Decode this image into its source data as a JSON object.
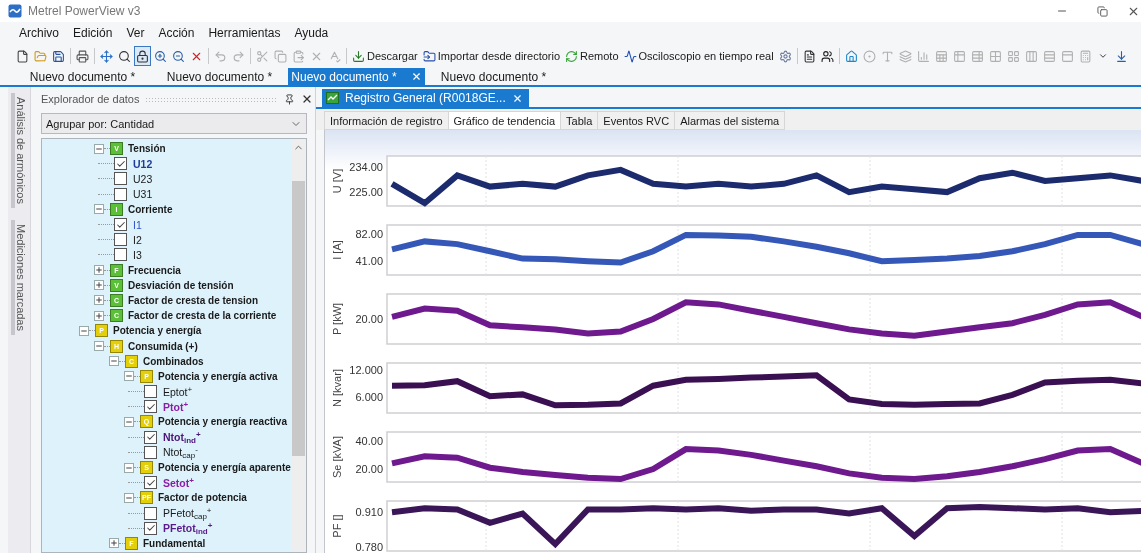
{
  "window": {
    "title": "Metrel PowerView v3"
  },
  "menu": [
    "Archivo",
    "Edición",
    "Ver",
    "Acción",
    "Herramientas",
    "Ayuda"
  ],
  "toolbar": [
    {
      "kind": "icon",
      "on": false,
      "disabled": false
    },
    {
      "kind": "icon",
      "on": false,
      "disabled": false
    },
    {
      "kind": "icon",
      "on": false,
      "disabled": false
    },
    {
      "kind": "separator"
    },
    {
      "kind": "icon",
      "on": false,
      "disabled": false
    },
    {
      "kind": "separator"
    },
    {
      "kind": "icon",
      "on": false,
      "disabled": false
    },
    {
      "kind": "icon",
      "on": false,
      "disabled": false
    },
    {
      "kind": "icon",
      "on": true,
      "disabled": false
    },
    {
      "kind": "icon",
      "on": false,
      "disabled": false
    },
    {
      "kind": "icon",
      "on": false,
      "disabled": false
    },
    {
      "kind": "icon",
      "on": false,
      "disabled": false
    },
    {
      "kind": "separator"
    },
    {
      "kind": "icon",
      "on": false,
      "disabled": true
    },
    {
      "kind": "icon",
      "on": false,
      "disabled": true
    },
    {
      "kind": "separator"
    },
    {
      "kind": "icon",
      "on": false,
      "disabled": true
    },
    {
      "kind": "icon",
      "on": false,
      "disabled": true
    },
    {
      "kind": "icon",
      "on": false,
      "disabled": true
    },
    {
      "kind": "icon",
      "on": false,
      "disabled": true
    },
    {
      "kind": "icon",
      "on": false,
      "disabled": true
    },
    {
      "kind": "separator"
    },
    {
      "kind": "button",
      "label": "Descargar"
    },
    {
      "kind": "button",
      "label": "Importar desde directorio"
    },
    {
      "kind": "button",
      "label": "Remoto"
    },
    {
      "kind": "button",
      "label": "Osciloscopio en tiempo real"
    },
    {
      "kind": "icon",
      "on": false,
      "disabled": false
    },
    {
      "kind": "separator"
    },
    {
      "kind": "icon",
      "on": false,
      "disabled": false
    },
    {
      "kind": "icon",
      "on": false,
      "disabled": false
    },
    {
      "kind": "separator"
    },
    {
      "kind": "icon",
      "on": false,
      "disabled": false
    },
    {
      "kind": "icon",
      "on": false,
      "disabled": true
    },
    {
      "kind": "icon",
      "on": false,
      "disabled": true
    },
    {
      "kind": "icon",
      "on": false,
      "disabled": true
    },
    {
      "kind": "icon",
      "on": false,
      "disabled": true
    },
    {
      "kind": "icon",
      "on": false,
      "disabled": true
    },
    {
      "kind": "icon",
      "on": false,
      "disabled": true
    },
    {
      "kind": "icon",
      "on": false,
      "disabled": true
    },
    {
      "kind": "icon",
      "on": false,
      "disabled": true
    },
    {
      "kind": "icon",
      "on": false,
      "disabled": true
    },
    {
      "kind": "icon",
      "on": false,
      "disabled": true
    },
    {
      "kind": "icon",
      "on": false,
      "disabled": true
    },
    {
      "kind": "icon",
      "on": false,
      "disabled": true
    },
    {
      "kind": "icon",
      "on": false,
      "disabled": true
    },
    {
      "kind": "overflow"
    },
    {
      "kind": "icon",
      "on": false,
      "disabled": false
    }
  ],
  "documents": [
    {
      "label": "Nuevo documento *",
      "selected": false
    },
    {
      "label": "Nuevo documento *",
      "selected": false
    },
    {
      "label": "Nuevo documento *",
      "selected": true
    },
    {
      "label": "Nuevo documento *",
      "selected": false
    }
  ],
  "side_tabs": [
    "Análisis de armónicos",
    "Mediciones marcadas"
  ],
  "explorer": {
    "title": "Explorador de datos",
    "group_by": "Agrupar por: Cantidad",
    "tree": [
      {
        "children": [
          {
            "label": "Tensión",
            "badge": "V",
            "color": "#5cbf38",
            "expanded": true,
            "children": [
              {
                "label": "U12",
                "checked": true,
                "bold": true,
                "color": "#1f3c9a"
              },
              {
                "label": "U23",
                "checked": false,
                "bold": false
              },
              {
                "label": "U31",
                "checked": false,
                "bold": false
              }
            ]
          },
          {
            "label": "Corriente",
            "badge": "I",
            "color": "#5cbf38",
            "expanded": true,
            "children": [
              {
                "label": "I1",
                "checked": true,
                "bold": false,
                "color": "#2f55c8"
              },
              {
                "label": "I2",
                "checked": false,
                "bold": false
              },
              {
                "label": "I3",
                "checked": false,
                "bold": false
              }
            ]
          },
          {
            "label": "Frecuencia",
            "badge": "F",
            "color": "#5cbf38",
            "expanded": false
          },
          {
            "label": "Desviación de tensión",
            "badge": "V",
            "color": "#5cbf38",
            "expanded": false
          },
          {
            "label": "Factor de cresta de tension",
            "badge": "C",
            "color": "#5cbf38",
            "expanded": false
          },
          {
            "label": "Factor de cresta de la corriente",
            "badge": "C",
            "color": "#5cbf38",
            "expanded": false
          }
        ]
      },
      {
        "label": "Potencia y energía",
        "badge": "P",
        "color": "#e3cf0a",
        "expanded": true,
        "children": [
          {
            "label": "Consumida (+)",
            "badge": "H",
            "color": "#e3cf0a",
            "expanded": true,
            "children": [
              {
                "label": "Combinados",
                "badge": "C",
                "color": "#e3cf0a",
                "expanded": true,
                "children": [
                  {
                    "label": "Potencia y energía activa",
                    "badge": "P",
                    "color": "#e3cf0a",
                    "expanded": true,
                    "children": [
                      {
                        "label": "Eptot$^{+}$",
                        "checked": false,
                        "bold": false
                      },
                      {
                        "label": "Ptot$^{+}$",
                        "checked": true,
                        "bold": true,
                        "color": "#8a1fa3"
                      }
                    ]
                  },
                  {
                    "label": "Potencia y energía reactiva",
                    "badge": "Q",
                    "color": "#e3cf0a",
                    "expanded": true,
                    "children": [
                      {
                        "label": "Ntot$_{ind}$$^{+}$",
                        "checked": true,
                        "bold": true,
                        "color": "#4a1578"
                      },
                      {
                        "label": "Ntot$_{cap}$$^{-}$",
                        "checked": false,
                        "bold": false
                      }
                    ]
                  },
                  {
                    "label": "Potencia y energía aparente",
                    "badge": "S",
                    "color": "#e3cf0a",
                    "expanded": true,
                    "children": [
                      {
                        "label": "Setot$^{+}$",
                        "checked": true,
                        "bold": true,
                        "color": "#8a1fa3"
                      }
                    ]
                  },
                  {
                    "label": "Factor de potencia",
                    "badge": "PF",
                    "color": "#e3cf0a",
                    "expanded": true,
                    "children": [
                      {
                        "label": "PFetot$_{cap}$$^{+}$",
                        "checked": false,
                        "bold": false
                      },
                      {
                        "label": "PFetot$_{ind}$$^{+}$",
                        "checked": true,
                        "bold": true,
                        "color": "#5a1a8a"
                      }
                    ]
                  }
                ]
              },
              {
                "label": "Fundamental",
                "badge": "F",
                "color": "#e3cf0a",
                "expanded": false
              }
            ]
          }
        ]
      }
    ]
  },
  "record_tab": {
    "label": "Registro General (R0018GE..."
  },
  "view_tabs": [
    {
      "label": "Información de registro",
      "selected": false
    },
    {
      "label": "Gráfico de tendencia",
      "selected": true
    },
    {
      "label": "Tabla",
      "selected": false
    },
    {
      "label": "Eventos RVC",
      "selected": false
    },
    {
      "label": "Alarmas del sistema",
      "selected": false
    }
  ],
  "charts": [
    {
      "chart_data": {
        "type": "line",
        "ylabel": "U [V]",
        "ylim": [
          220,
          238
        ],
        "yticks": [
          {
            "value": 225,
            "label": "225.00"
          },
          {
            "value": 234,
            "label": "234.00"
          }
        ],
        "series": [
          {
            "color": "#1b2b6e",
            "values": [
              228,
              221,
              231,
              227,
              228,
              227,
              231,
              233,
              228,
              227,
              228,
              227,
              228,
              231,
              225,
              227,
              226,
              225,
              230,
              232,
              229,
              230,
              231,
              229
            ]
          }
        ]
      }
    },
    {
      "chart_data": {
        "type": "line",
        "ylabel": "I [A]",
        "ylim": [
          19,
          95
        ],
        "yticks": [
          {
            "value": 41,
            "label": "41.00"
          },
          {
            "value": 82,
            "label": "82.00"
          }
        ],
        "series": [
          {
            "color": "#3558b8",
            "values": [
              58,
              70,
              66,
              55,
              44,
              43,
              40,
              38,
              55,
              80,
              79,
              77,
              70,
              62,
              52,
              40,
              42,
              44,
              48,
              55,
              66,
              80,
              80,
              66
            ]
          }
        ]
      }
    },
    {
      "kind": "trend-picture",
      "ylabel": "P [kW]",
      "tick": "20.00",
      "color": "#6e1a8e"
    },
    {
      "chart_data": {
        "type": "line",
        "ylabel": "N [kvar]",
        "ylim": [
          2.5,
          13.5
        ],
        "yticks": [
          {
            "value": 6,
            "label": "6.000"
          },
          {
            "value": 12,
            "label": "12.000"
          }
        ],
        "series": [
          {
            "color": "#3b1052",
            "values": [
              8.5,
              8.6,
              9.5,
              6.2,
              6.6,
              4.2,
              4.3,
              4.6,
              8.5,
              9.8,
              10,
              10.3,
              10.5,
              10.8,
              5.5,
              4.5,
              4.3,
              4.5,
              4.6,
              6.5,
              9.2,
              9.6,
              9.8,
              9
            ]
          }
        ]
      }
    },
    {
      "chart_data": {
        "type": "line",
        "ylabel": "Se [kVA]",
        "ylim": [
          11,
          46
        ],
        "yticks": [
          {
            "value": 20,
            "label": "20.00"
          },
          {
            "value": 40,
            "label": "40.00"
          }
        ],
        "series": [
          {
            "color": "#6e1a8e",
            "values": [
              24,
              29,
              28,
              21,
              18,
              16,
              14,
              13,
              20,
              34,
              33,
              30,
              26,
              22,
              17,
              14,
              13,
              15,
              18,
              22,
              27,
              33,
              34,
              24
            ]
          }
        ]
      }
    },
    {
      "chart_data": {
        "type": "line",
        "ylabel": "PF []",
        "ylim": [
          0.764,
          0.952
        ],
        "yticks": [
          {
            "value": 0.78,
            "label": "0.780"
          },
          {
            "value": 0.91,
            "label": "0.910"
          }
        ],
        "series": [
          {
            "color": "#3a1658",
            "values": [
              0.91,
              0.925,
              0.92,
              0.87,
              0.905,
              0.79,
              0.92,
              0.92,
              0.925,
              0.92,
              0.925,
              0.915,
              0.92,
              0.92,
              0.905,
              0.925,
              0.82,
              0.925,
              0.93,
              0.925,
              0.92,
              0.925,
              0.91,
              0.915
            ]
          }
        ]
      }
    }
  ]
}
